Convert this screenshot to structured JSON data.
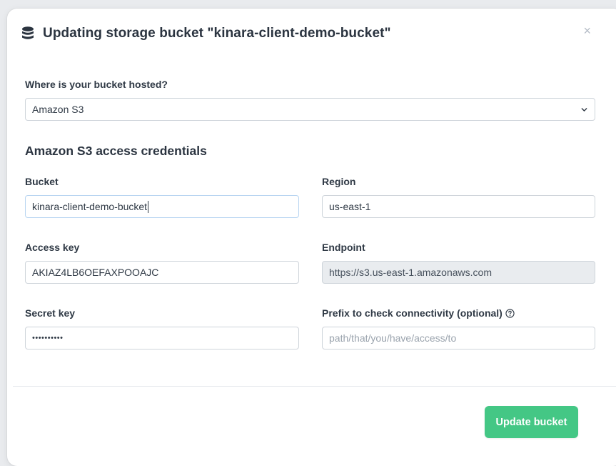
{
  "modal": {
    "title": "Updating storage bucket \"kinara-client-demo-bucket\"",
    "close_label": "×"
  },
  "hosting": {
    "label": "Where is your bucket hosted?",
    "selected": "Amazon S3"
  },
  "credentials": {
    "section_title": "Amazon S3 access credentials",
    "bucket": {
      "label": "Bucket",
      "value": "kinara-client-demo-bucket"
    },
    "region": {
      "label": "Region",
      "value": "us-east-1"
    },
    "access_key": {
      "label": "Access key",
      "value": "AKIAZ4LB6OEFAXPOOAJC"
    },
    "endpoint": {
      "label": "Endpoint",
      "value": "https://s3.us-east-1.amazonaws.com"
    },
    "secret_key": {
      "label": "Secret key",
      "value": "••••••••••"
    },
    "prefix": {
      "label": "Prefix to check connectivity (optional)",
      "placeholder": "path/that/you/have/access/to"
    }
  },
  "footer": {
    "submit_label": "Update bucket"
  },
  "colors": {
    "primary": "#44c785",
    "text": "#2b3440",
    "border": "#ced4da",
    "readonly_bg": "#e9ecef"
  },
  "icons": [
    "database-icon",
    "close-icon",
    "chevron-down-icon",
    "question-circle-icon"
  ]
}
